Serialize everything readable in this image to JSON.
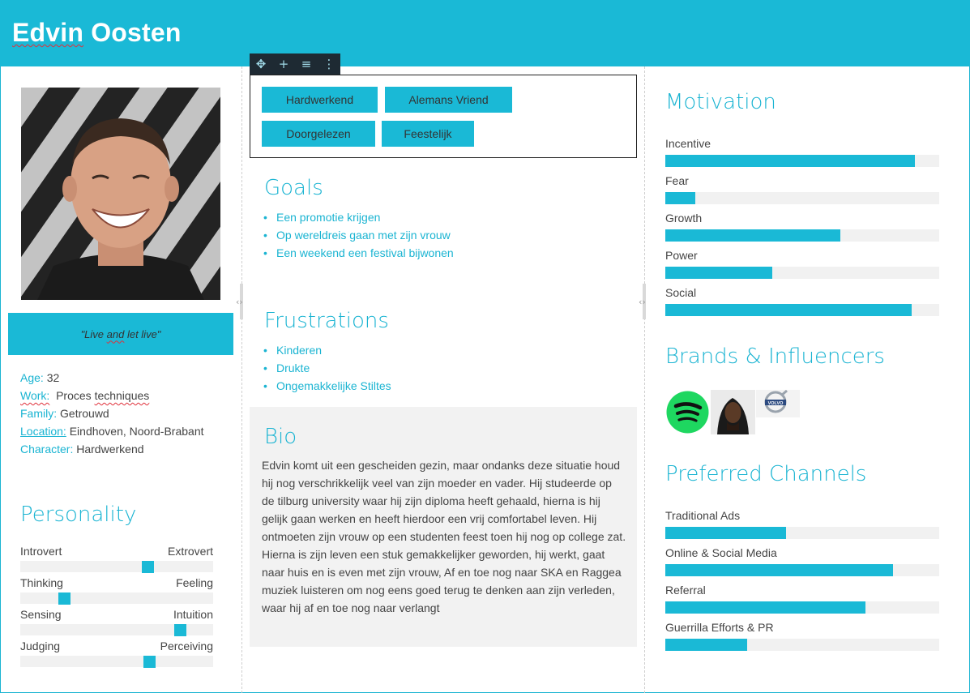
{
  "header": {
    "name_first": "Edvin",
    "name_last": "Oosten"
  },
  "quote": {
    "before": "\"Live ",
    "underlined": "and",
    "after": " let live\""
  },
  "facts": {
    "age_label": "Age:",
    "age_value": "32",
    "work_label": "Work:",
    "work_value_a": "Proces ",
    "work_value_b": "techniques",
    "family_label": "Family:",
    "family_value": "Getrouwd",
    "location_label": "Location:",
    "location_value": "Eindhoven, Noord-Brabant",
    "character_label": "Character:",
    "character_value": "Hardwerkend"
  },
  "personality": {
    "title": "Personality",
    "rows": [
      {
        "left": "Introvert",
        "right": "Extrovert",
        "value": 0.66
      },
      {
        "left": "Thinking",
        "right": "Feeling",
        "value": 0.23
      },
      {
        "left": "Sensing",
        "right": "Intuition",
        "value": 0.83
      },
      {
        "left": "Judging",
        "right": "Perceiving",
        "value": 0.67
      }
    ]
  },
  "toolbar": {
    "icons": [
      "move-icon",
      "add-icon",
      "align-icon",
      "more-icon"
    ]
  },
  "tags": [
    "Hardwerkend",
    "Alemans Vriend",
    "Doorgelezen",
    "Feestelijk"
  ],
  "goals": {
    "title": "Goals",
    "items": [
      "Een promotie krijgen",
      "Op wereldreis gaan met zijn vrouw",
      "Een weekend een festival bijwonen"
    ]
  },
  "frustrations": {
    "title": "Frustrations",
    "items": [
      "Kinderen",
      "Drukte",
      "Ongemakkelijke Stiltes"
    ]
  },
  "bio": {
    "title": "Bio",
    "text": "Edvin komt uit een gescheiden gezin, maar ondanks deze situatie houd hij nog verschrikkelijk veel van zijn moeder en vader. Hij studeerde op de tilburg university waar hij zijn diploma heeft gehaald, hierna is hij gelijk gaan werken en heeft hierdoor een vrij comfortabel leven. Hij ontmoeten zijn vrouw op een studenten feest toen hij nog op college zat. Hierna is zijn leven een stuk gemakkelijker geworden, hij werkt, gaat naar huis en is even met zijn vrouw, Af en toe nog naar SKA en Raggea muziek luisteren om nog eens goed terug te denken aan zijn verleden, waar hij af en toe nog naar verlangt"
  },
  "motivation": {
    "title": "Motivation",
    "items": [
      {
        "label": "Incentive",
        "value": 0.91
      },
      {
        "label": "Fear",
        "value": 0.11
      },
      {
        "label": "Growth",
        "value": 0.64
      },
      {
        "label": "Power",
        "value": 0.39
      },
      {
        "label": "Social",
        "value": 0.9
      }
    ]
  },
  "brands": {
    "title": "Brands & Influencers",
    "logos": [
      "spotify-logo",
      "bob-marley-photo",
      "volvo-logo"
    ],
    "volvo_text": "VOLVO"
  },
  "channels": {
    "title": "Preferred Channels",
    "items": [
      {
        "label": "Traditional Ads",
        "value": 0.44
      },
      {
        "label": "Online & Social Media",
        "value": 0.83
      },
      {
        "label": "Referral",
        "value": 0.73
      },
      {
        "label": "Guerrilla Efforts & PR",
        "value": 0.3
      }
    ]
  },
  "colors": {
    "accent": "#1ab9d6",
    "track": "#f1f1f1",
    "bio_bg": "#f2f2f2",
    "toolbar": "#1e2a33"
  }
}
